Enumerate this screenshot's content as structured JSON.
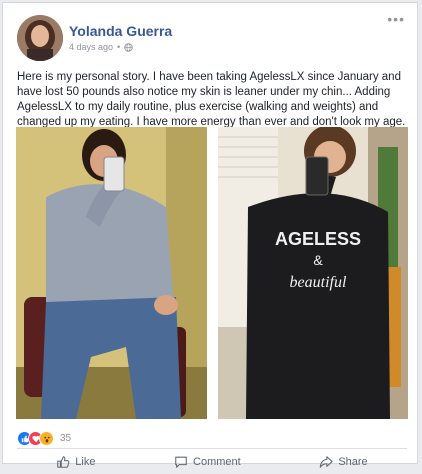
{
  "post": {
    "author": "Yolanda Guerra",
    "time": "4 days ago",
    "separator": "•",
    "more_label": "•••",
    "text": "Here is my personal story. I have been taking AgelessLX since January and have lost 50 pounds also notice my skin is leaner under my chin... Adding AgelessLX to my daily routine, plus exercise (walking and weights) and changed up my eating. I have more energy than ever and don't look my age. I Love Living Ageless!",
    "photo_shirt_text": [
      "AGELESS",
      "&",
      "beautiful"
    ]
  },
  "reactions": {
    "count": "35",
    "icons": [
      "like-icon",
      "love-icon",
      "wow-icon"
    ],
    "colors": {
      "like": "#1877f2",
      "love": "#f33e58",
      "wow": "#f7b125"
    }
  },
  "actions": {
    "like": "Like",
    "comment": "Comment",
    "share": "Share"
  },
  "colors": {
    "author": "#365899",
    "text": "#1d2129",
    "muted": "#90949c"
  }
}
